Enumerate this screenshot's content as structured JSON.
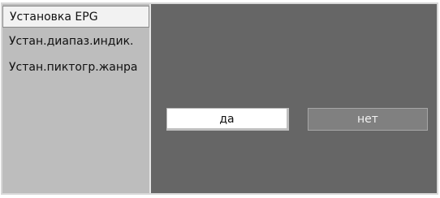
{
  "menu": {
    "items": [
      {
        "label": "Установка EPG",
        "selected": true
      },
      {
        "label": "Устан.диапаз.индик.",
        "selected": false
      },
      {
        "label": "Устан.пиктогр.жанра",
        "selected": false
      }
    ]
  },
  "dialog": {
    "yes_label": "да",
    "no_label": "нет",
    "focused": "yes"
  },
  "colors": {
    "background": "#666666",
    "sidebar": "#bdbdbd",
    "selected_item": "#f2f2f2",
    "button_focused": "#ffffff",
    "button_unfocused": "#808080"
  }
}
